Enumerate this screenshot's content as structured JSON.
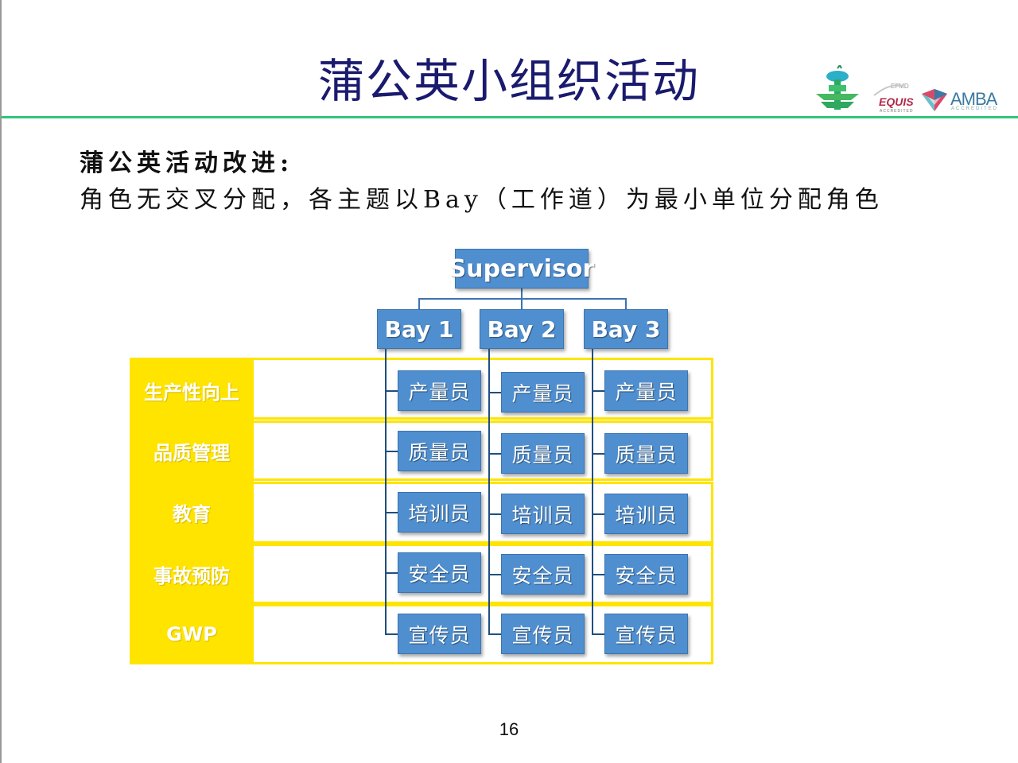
{
  "slide": {
    "title": "蒲公英小组织活动",
    "subtitle_line1": "蒲公英活动改进:",
    "subtitle_line2": "角色无交叉分配，各主题以Bay（工作道）为最小单位分配角色",
    "page_number": "16"
  },
  "logos": {
    "equis_small": "EFMD",
    "equis": "EQUIS",
    "equis_accredited": "ACCREDITED",
    "amba": "AMBA",
    "amba_accredited": "ACCREDITED"
  },
  "colors": {
    "title": "#1a1a6e",
    "rule": "#2fc67a",
    "box": "#4f8fd0",
    "category": "#ffe400"
  },
  "diagram": {
    "supervisor": "Supervisor",
    "bays": [
      "Bay 1",
      "Bay 2",
      "Bay 3"
    ],
    "categories": [
      "生产性向上",
      "品质管理",
      "教育",
      "事故预防",
      "GWP"
    ],
    "roles": [
      "产量员",
      "质量员",
      "培训员",
      "安全员",
      "宣传员"
    ]
  }
}
